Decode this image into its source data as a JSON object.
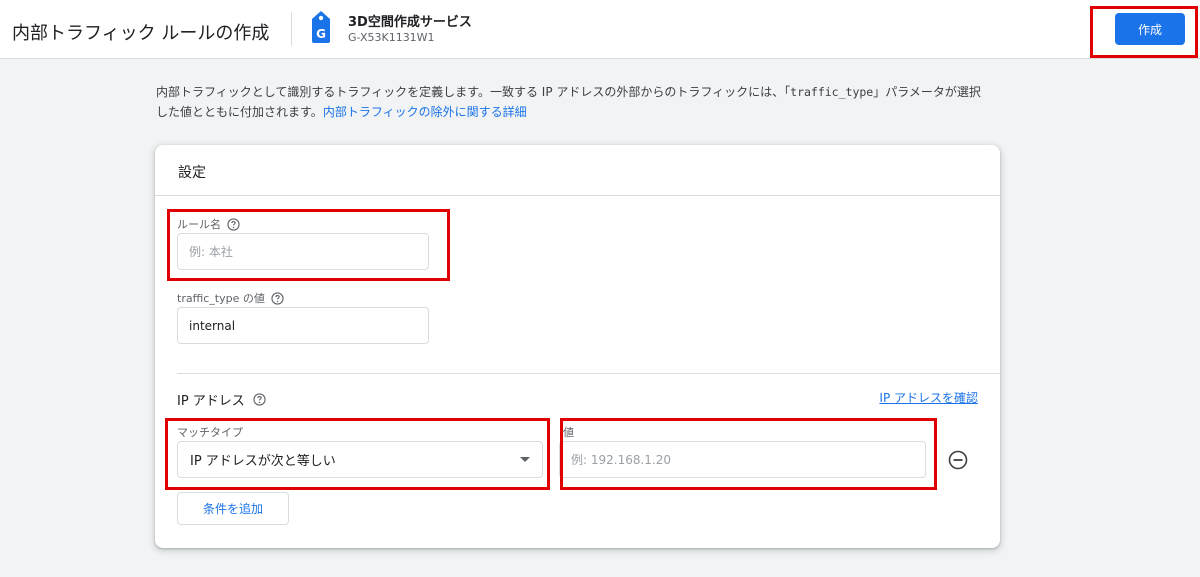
{
  "header": {
    "title": "内部トラフィック ルールの作成",
    "property_name": "3D空間作成サービス",
    "property_id": "G-X53K1131W1",
    "property_icon": "ga-tag-icon",
    "create_label": "作成",
    "accent_color": "#1a73e8"
  },
  "description": {
    "part1": "内部トラフィックとして識別するトラフィックを定義します。一致する IP アドレスの外部からのトラフィックには、「",
    "code": "traffic_type",
    "part2": "」パラメータが選択した値とともに付加されます。",
    "link": "内部トラフィックの除外に関する詳細"
  },
  "settings": {
    "title": "設定",
    "rule_name": {
      "label": "ルール名",
      "placeholder": "例: 本社",
      "value": ""
    },
    "traffic_type": {
      "label": "traffic_type の値",
      "value": "internal"
    }
  },
  "ip": {
    "section_label": "IP アドレス",
    "check_link": "IP アドレスを確認",
    "match_type": {
      "label": "マッチタイプ",
      "selected": "IP アドレスが次と等しい"
    },
    "value": {
      "label": "値",
      "placeholder": "例: 192.168.1.20",
      "value": ""
    },
    "add_condition_label": "条件を追加"
  },
  "highlight_color": "#e00000"
}
